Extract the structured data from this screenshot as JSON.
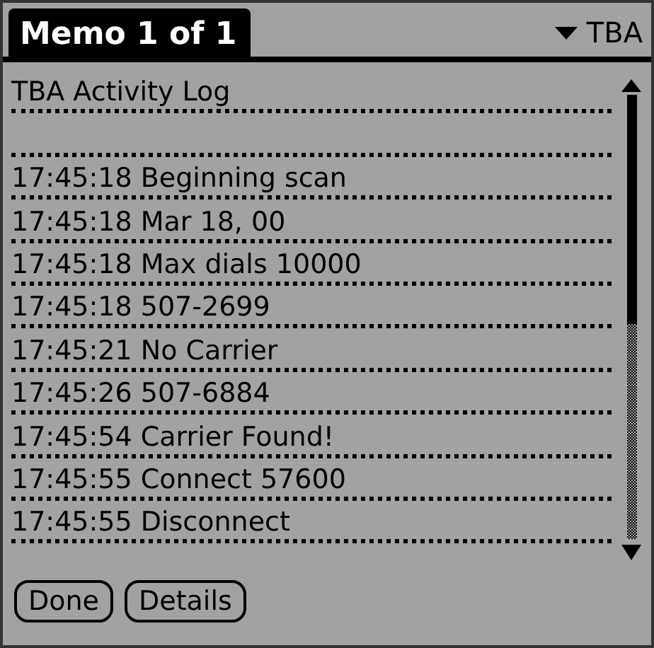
{
  "window": {
    "title": "Memo 1 of 1"
  },
  "category": {
    "label": "TBA"
  },
  "memo_heading": "TBA Activity Log",
  "log_lines": [
    "17:45:18 Beginning scan",
    "17:45:18 Mar 18, 00",
    "17:45:18 Max dials 10000",
    "17:45:18 507-2699",
    "17:45:21 No Carrier",
    "17:45:26 507-6884",
    "17:45:54 Carrier Found!",
    "17:45:55 Connect 57600",
    "17:45:55 Disconnect"
  ],
  "buttons": [
    "Done",
    "Details"
  ]
}
